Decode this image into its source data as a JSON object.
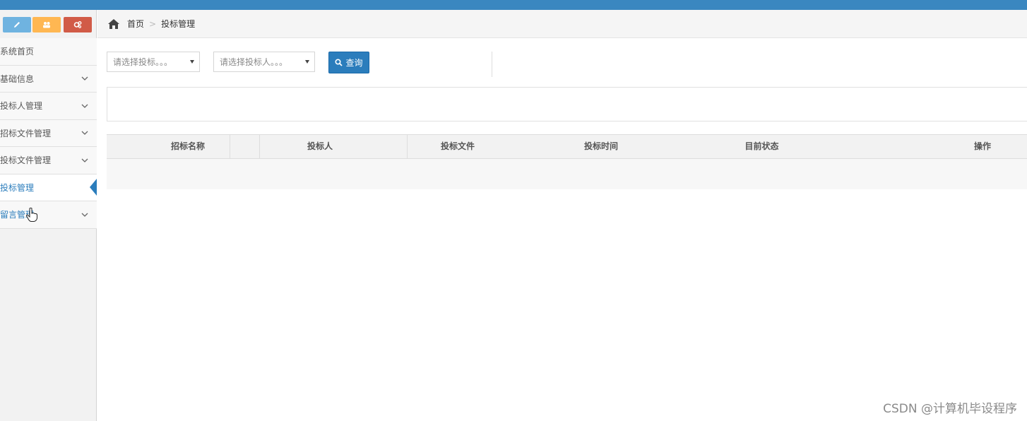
{
  "colors": {
    "topbar": "#3a87c0",
    "primary": "#2b7dbc",
    "shortcut_blue": "#6fb3e0",
    "shortcut_orange": "#ffb752",
    "shortcut_red": "#d15b47"
  },
  "sidebar": {
    "shortcuts": [
      {
        "icon": "pencil-icon"
      },
      {
        "icon": "users-icon"
      },
      {
        "icon": "cogs-icon"
      }
    ],
    "items": [
      {
        "label": "系统首页"
      },
      {
        "label": "基础信息"
      },
      {
        "label": "投标人管理"
      },
      {
        "label": "招标文件管理"
      },
      {
        "label": "投标文件管理"
      },
      {
        "label": "投标管理"
      },
      {
        "label": "留言管理"
      }
    ]
  },
  "breadcrumb": {
    "home": "首页",
    "current": "投标管理"
  },
  "filters": {
    "tender_select": "请选择投标。。。",
    "bidder_select": "请选择投标人。。。",
    "query_button": "查询"
  },
  "table": {
    "columns": [
      "招标名称",
      "投标人",
      "投标文件",
      "投标时间",
      "目前状态",
      "操作"
    ]
  },
  "watermark": "CSDN @计算机毕设程序"
}
